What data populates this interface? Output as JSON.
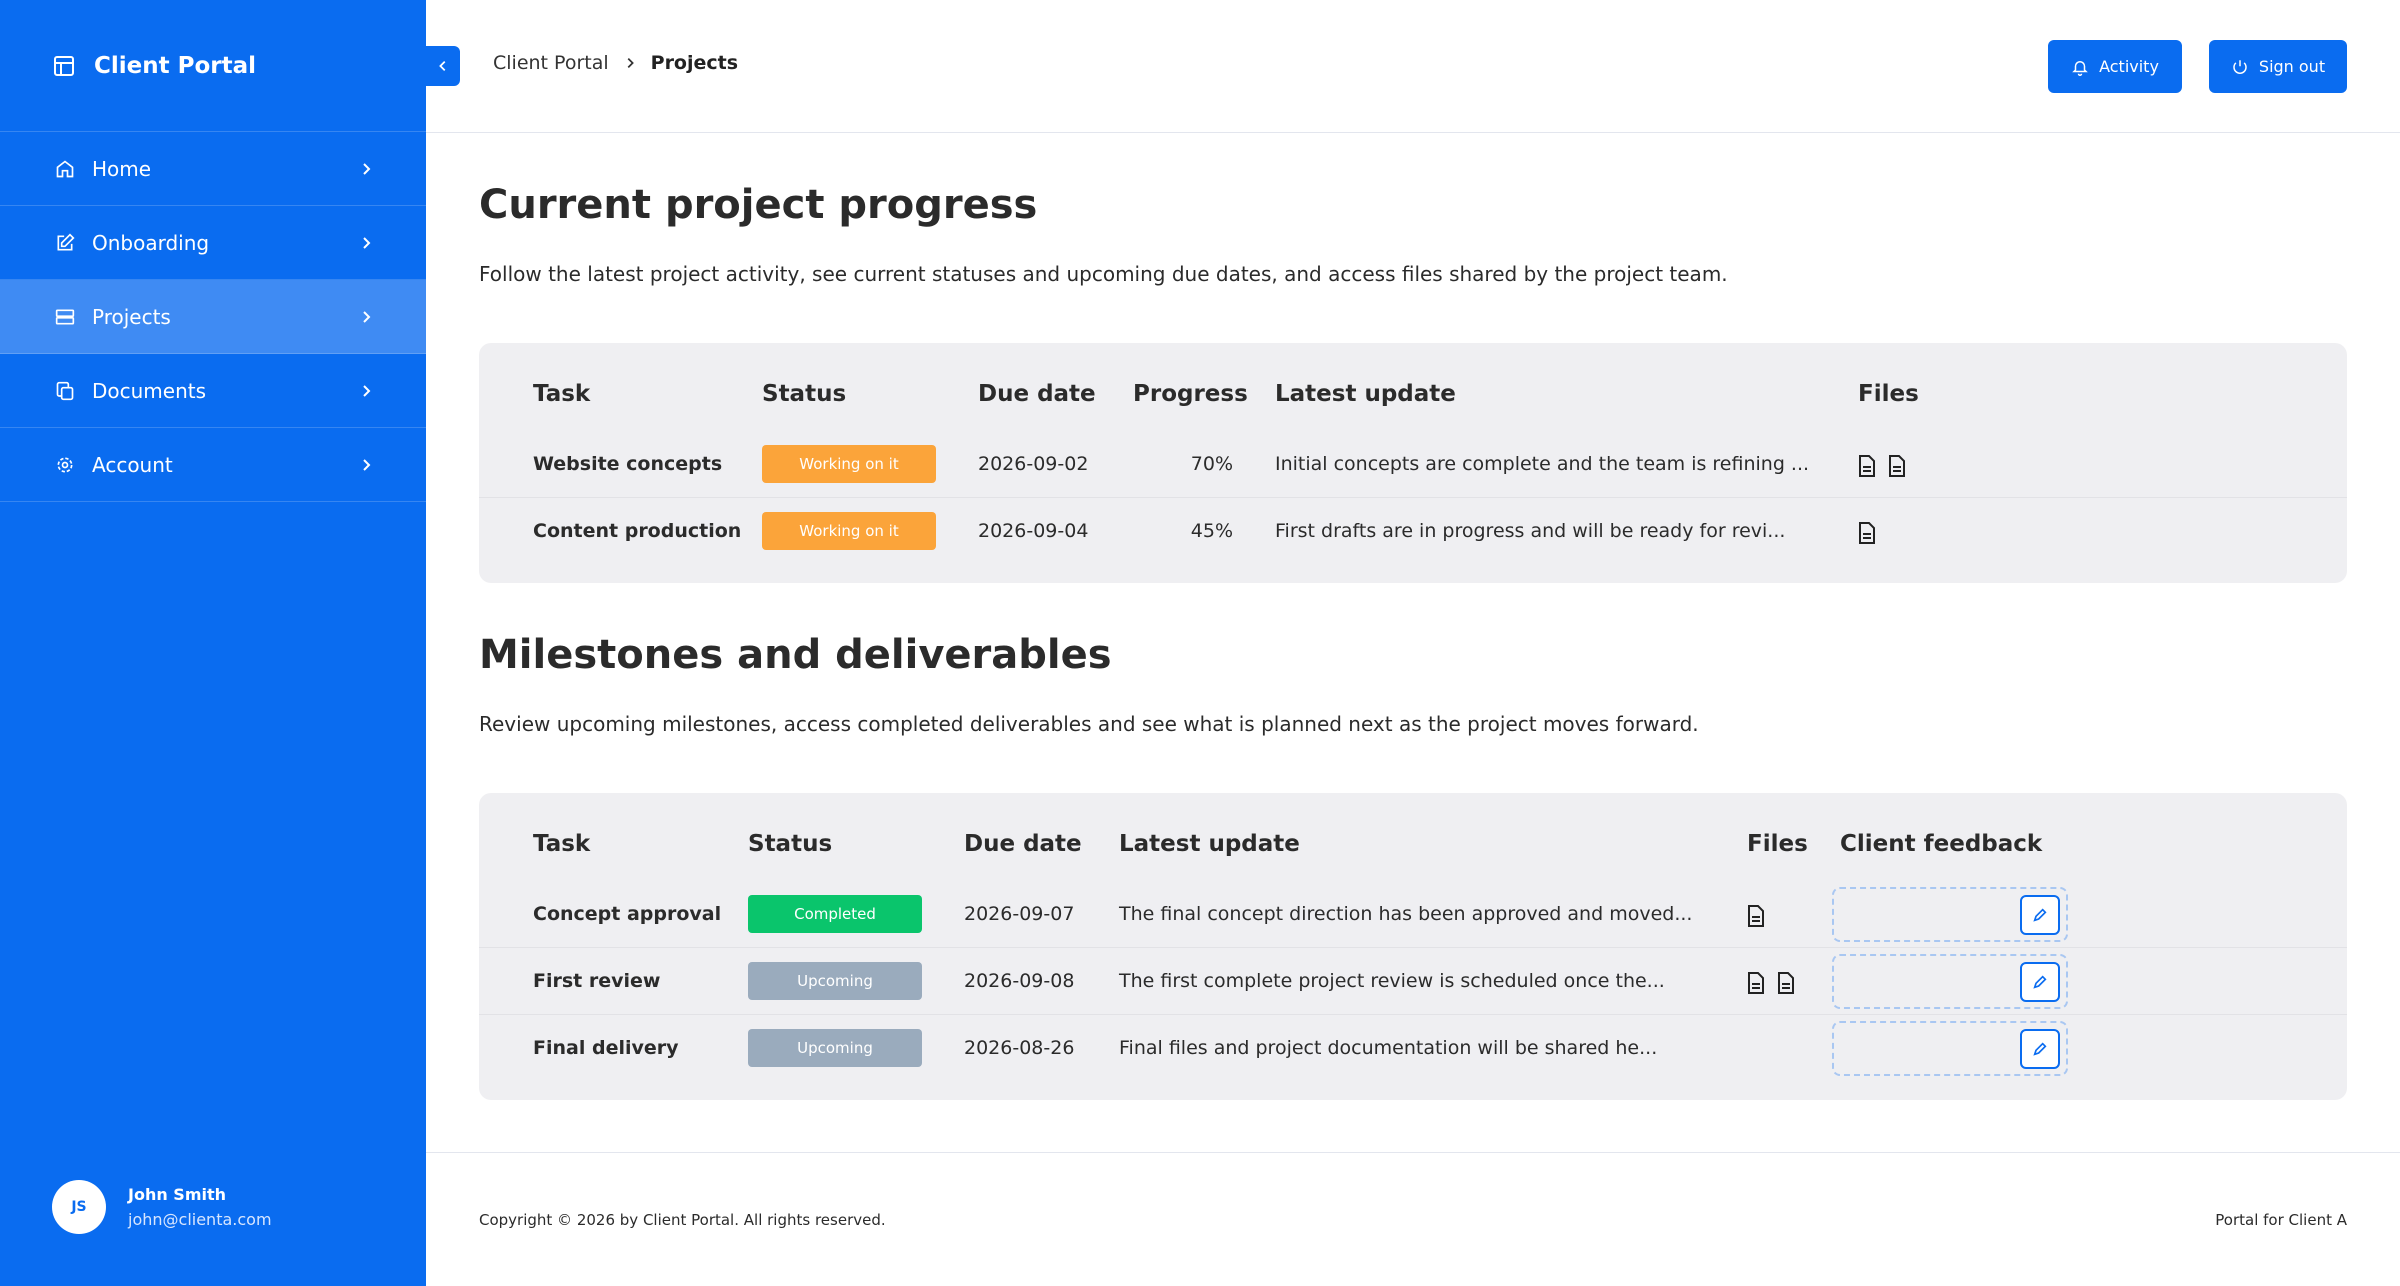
{
  "sidebar": {
    "brand": "Client Portal",
    "items": [
      {
        "label": "Home"
      },
      {
        "label": "Onboarding"
      },
      {
        "label": "Projects"
      },
      {
        "label": "Documents"
      },
      {
        "label": "Account"
      }
    ],
    "user": {
      "initials": "JS",
      "name": "John Smith",
      "email": "john@clienta.com"
    }
  },
  "header": {
    "breadcrumb_root": "Client Portal",
    "breadcrumb_current": "Projects",
    "activity_label": "Activity",
    "signout_label": "Sign out"
  },
  "progress": {
    "title": "Current project progress",
    "description": "Follow the latest project activity, see current statuses and upcoming due dates, and access files shared by the project team.",
    "columns": [
      "Task",
      "Status",
      "Due date",
      "Progress",
      "Latest update",
      "Files"
    ],
    "rows": [
      {
        "task": "Website concepts",
        "status": "Working on it",
        "due": "2026-09-02",
        "progress": "70%",
        "update": "Initial concepts are complete and the team is refining ...",
        "files": 2
      },
      {
        "task": "Content production",
        "status": "Working on it",
        "due": "2026-09-04",
        "progress": "45%",
        "update": "First drafts are in progress and will be ready for revi...",
        "files": 1
      }
    ]
  },
  "milestones": {
    "title": "Milestones and deliverables",
    "description": "Review upcoming milestones, access completed deliverables and see what is planned next as the project moves forward.",
    "columns": [
      "Task",
      "Status",
      "Due date",
      "Latest update",
      "Files",
      "Client feedback"
    ],
    "rows": [
      {
        "task": "Concept approval",
        "status": "Completed",
        "due": "2026-09-07",
        "update": "The final concept direction has been approved and moved...",
        "files": 1
      },
      {
        "task": "First review",
        "status": "Upcoming",
        "due": "2026-09-08",
        "update": "The first complete project review is scheduled once the...",
        "files": 2
      },
      {
        "task": "Final delivery",
        "status": "Upcoming",
        "due": "2026-08-26",
        "update": "Final files and project documentation will be shared he...",
        "files": 0
      }
    ]
  },
  "footer": {
    "copyright": "Copyright © 2026 by Client Portal. All rights reserved.",
    "portal_for": "Portal for Client A"
  },
  "colors": {
    "accent": "#0a6cf0",
    "working": "#fba43a",
    "completed": "#0ac56c",
    "upcoming": "#9aabbd"
  },
  "icons": {
    "brand": "layout-icon",
    "nav": [
      "home-icon",
      "edit-icon",
      "server-icon",
      "copy-icon",
      "gear-icon"
    ],
    "activity": "bell-icon",
    "signout": "power-icon",
    "file": "file-icon",
    "feedback": "pencil-icon"
  }
}
